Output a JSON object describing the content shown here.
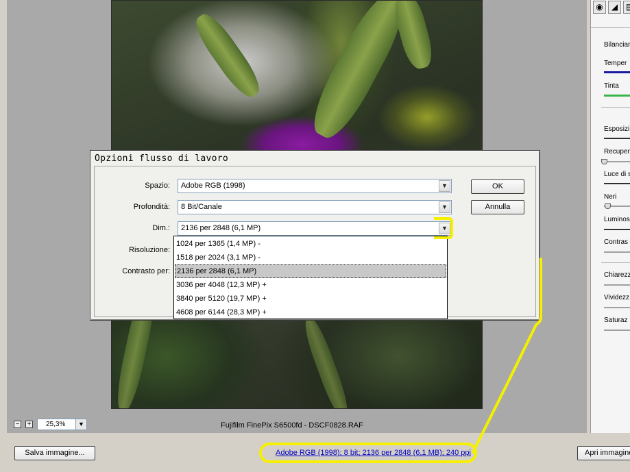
{
  "preview": {
    "zoom_value": "25,3%",
    "zoom_minus": "−",
    "zoom_plus": "+",
    "zoom_dropdown_icon": "chevron-down-icon",
    "camera_label": "Fujifilm FinePix S6500fd  -  DSCF0828.RAF"
  },
  "right_panel": {
    "tools": [
      "aperture-icon",
      "curve-icon",
      "tool-icon"
    ],
    "labels": [
      "Bilancian",
      "Temper",
      "Tinta",
      "Esposizi",
      "Recuper",
      "Luce di s",
      "Neri",
      "Luminos",
      "Contras",
      "Chiarezz",
      "Vividezz",
      "Saturaz"
    ],
    "accent_blue": "#1a1aa0",
    "accent_green": "#39b54a"
  },
  "dialog": {
    "title": "Opzioni flusso di lavoro",
    "labels": {
      "spazio": "Spazio:",
      "profondita": "Profondità:",
      "dim": "Dim.:",
      "risoluzione": "Risoluzione:",
      "contrasto": "Contrasto per:"
    },
    "values": {
      "spazio": "Adobe RGB (1998)",
      "profondita": "8 Bit/Canale",
      "dim": "2136 per 2848 (6,1 MP)"
    },
    "ok_label": "OK",
    "cancel_label": "Annulla",
    "dim_options": [
      "1024 per 1365 (1,4 MP)  -",
      "1518 per 2024 (3,1 MP)  -",
      "2136 per 2848 (6,1 MP)",
      "3036 per 4048 (12,3 MP)  +",
      "3840 per 5120 (19,7 MP)  +",
      "4608 per 6144 (28,3 MP)  +"
    ],
    "dim_selected_index": 2
  },
  "bottom_bar": {
    "save_label": "Salva immagine...",
    "info_link": "Adobe RGB (1998); 8 bit; 2136 per 2848 (6,1 MB); 240 ppi",
    "open_label": "Apri immagine"
  },
  "annotation_color": "#f5f000"
}
